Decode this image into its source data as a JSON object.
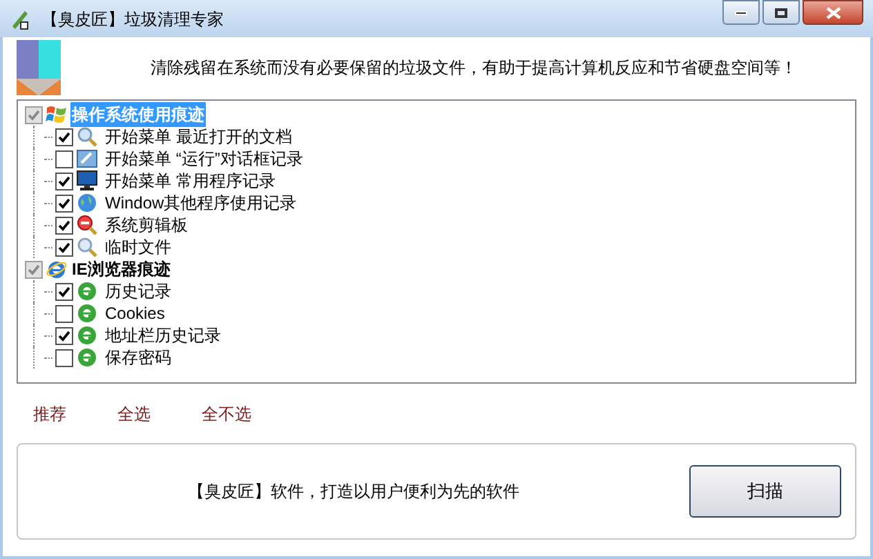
{
  "window": {
    "title": "【臭皮匠】垃圾清理专家"
  },
  "header": {
    "message": "清除残留在系统而没有必要保留的垃圾文件，有助于提高计算机反应和节省硬盘空间等！"
  },
  "tree": [
    {
      "label": "操作系统使用痕迹",
      "checked": true,
      "selected": true,
      "children": [
        {
          "label": "开始菜单 最近打开的文档",
          "checked": true
        },
        {
          "label": "开始菜单 “运行”对话框记录",
          "checked": false
        },
        {
          "label": "开始菜单 常用程序记录",
          "checked": true
        },
        {
          "label": "Window其他程序使用记录",
          "checked": true
        },
        {
          "label": "系统剪辑板",
          "checked": true
        },
        {
          "label": "临时文件",
          "checked": true
        }
      ]
    },
    {
      "label": "IE浏览器痕迹",
      "checked": true,
      "selected": false,
      "children": [
        {
          "label": "历史记录",
          "checked": true
        },
        {
          "label": "Cookies",
          "checked": false
        },
        {
          "label": "地址栏历史记录",
          "checked": true
        },
        {
          "label": "保存密码",
          "checked": false
        }
      ]
    }
  ],
  "links": [
    "推荐",
    "全选",
    "全不选"
  ],
  "footer": {
    "slogan": "【臭皮匠】软件，打造以用户便利为先的软件",
    "button": "扫描"
  }
}
